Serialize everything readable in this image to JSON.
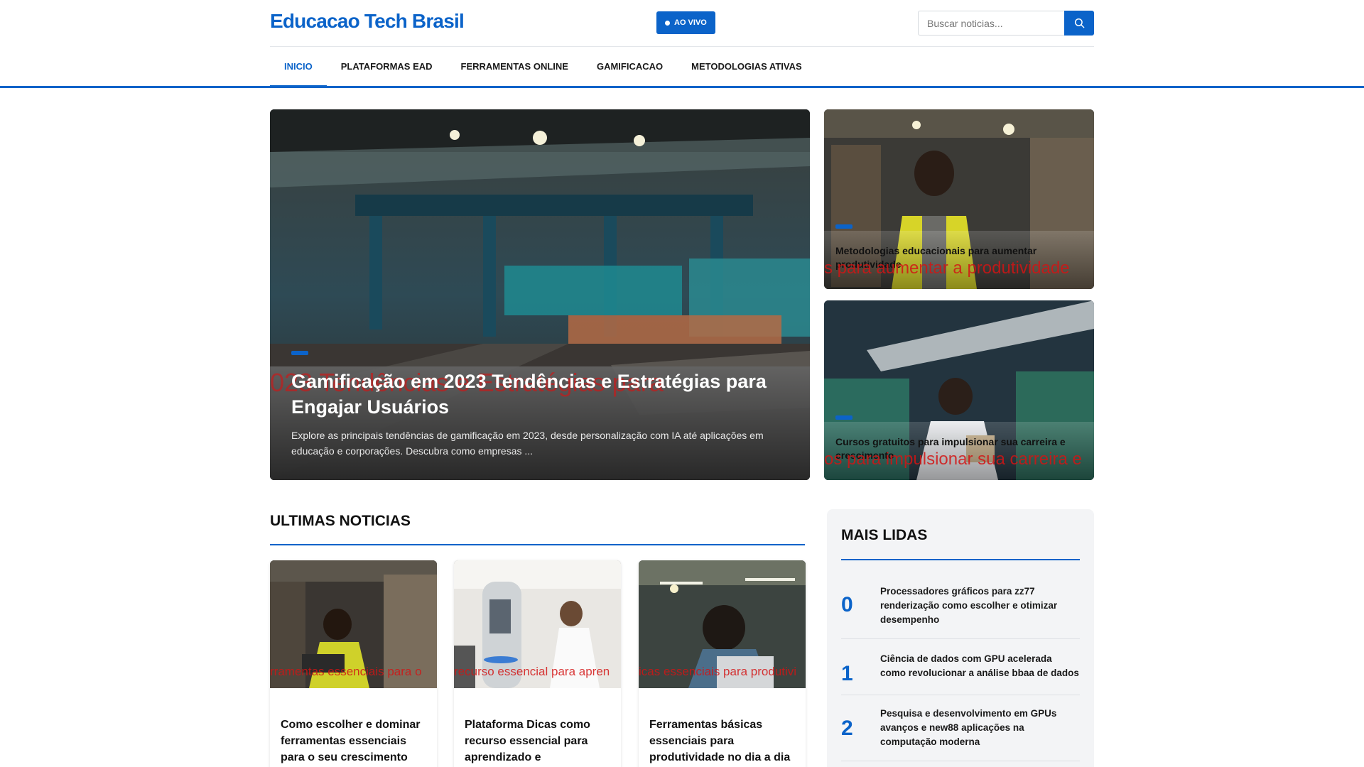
{
  "site": {
    "logo": "Educacao Tech Brasil",
    "live_label": "AO VIVO",
    "search_placeholder": "Buscar noticias..."
  },
  "nav": {
    "items": [
      "INICIO",
      "PLATAFORMAS EAD",
      "FERRAMENTAS ONLINE",
      "GAMIFICACAO",
      "METODOLOGIAS ATIVAS"
    ],
    "active": "INICIO"
  },
  "hero": {
    "main": {
      "title": "Gamificação em 2023 Tendências e Estratégias para Engajar Usuários",
      "excerpt": "Explore as principais tendências de gamificação em 2023, desde personalização com IA até aplicações em educação e corporações. Descubra como empresas ...",
      "watermark": "023 Tendências e Estratégias para"
    },
    "side": [
      {
        "title": "Metodologias educacionais para aumentar produtividade",
        "watermark": "s para aumentar a produtividade"
      },
      {
        "title": "Cursos gratuitos para impulsionar sua carreira e crescimento",
        "watermark": "os para impulsionar sua carreira e"
      }
    ]
  },
  "latest": {
    "title": "ULTIMAS NOTICIAS",
    "cards": [
      {
        "title": "Como escolher e dominar ferramentas essenciais para o seu crescimento",
        "watermark": "rramentas essenciais para o"
      },
      {
        "title": "Plataforma Dicas como recurso essencial para aprendizado e produtividade",
        "watermark": "recurso essencial para apren"
      },
      {
        "title": "Ferramentas básicas essenciais para produtividade no dia a dia",
        "watermark": "icas essenciais para produtivi"
      }
    ]
  },
  "popular": {
    "title": "MAIS LIDAS",
    "items": [
      {
        "rank": "0",
        "title": "Processadores gráficos para zz77 renderização como escolher e otimizar desempenho"
      },
      {
        "rank": "1",
        "title": "Ciência de dados com GPU acelerada como revolucionar a análise bbaa de dados"
      },
      {
        "rank": "2",
        "title": "Pesquisa e desenvolvimento em GPUs avanços e new88 aplicações na computação moderna"
      }
    ]
  },
  "colors": {
    "accent": "#0b63c9",
    "watermark": "#d21414"
  },
  "icons": {
    "search": "search-icon",
    "live": "live-dot-icon"
  }
}
